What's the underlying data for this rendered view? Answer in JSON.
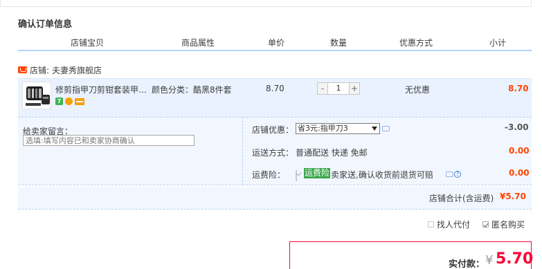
{
  "section_title": "确认订单信息",
  "columns": [
    "店铺宝贝",
    "商品属性",
    "单价",
    "数量",
    "优惠方式",
    "小计"
  ],
  "shop": {
    "label": "店铺:",
    "name": "夫妻秀旗舰店"
  },
  "item": {
    "title": "修剪指甲刀剪钳套装甲…",
    "props": "颜色分类：酷黑8件套",
    "price": "8.70",
    "qty_minus": "-",
    "quantity": "1",
    "qty_plus": "+",
    "discount": "无优惠",
    "subtotal": "8.70",
    "badge_7": "7"
  },
  "message": {
    "label": "给卖家留言：",
    "placeholder": "选填:填写内容已和卖家协商确认"
  },
  "shop_coupon": {
    "label": "店铺优惠：",
    "selected": "省3元:指甲刀3",
    "amount": "-3.00"
  },
  "shipping": {
    "label": "运送方式：",
    "value": "普通配送 快递 免邮",
    "amount": "0.00"
  },
  "insurance": {
    "label": "运费险：",
    "tag": "运费险",
    "desc": "卖家送,确认收货前退货可赔",
    "amount": "0.00",
    "help": "?"
  },
  "shop_total": {
    "label": "店铺合计(含运费)",
    "amount": "¥5.70"
  },
  "options": {
    "proxy_pay": "找人代付",
    "anonymous": "匿名购买"
  },
  "payment": {
    "label": "实付款：",
    "currency": "¥",
    "amount": "5.70"
  },
  "colors": {
    "accent_red": "#ff0036",
    "price_orange": "#ff4400",
    "row_blue": "#eaf2ff",
    "header_line": "#b2d1ff"
  },
  "icons": [
    "shop-tag-icon",
    "chat-icon",
    "help-icon",
    "checkbox-icon",
    "dropdown-arrow-icon"
  ]
}
